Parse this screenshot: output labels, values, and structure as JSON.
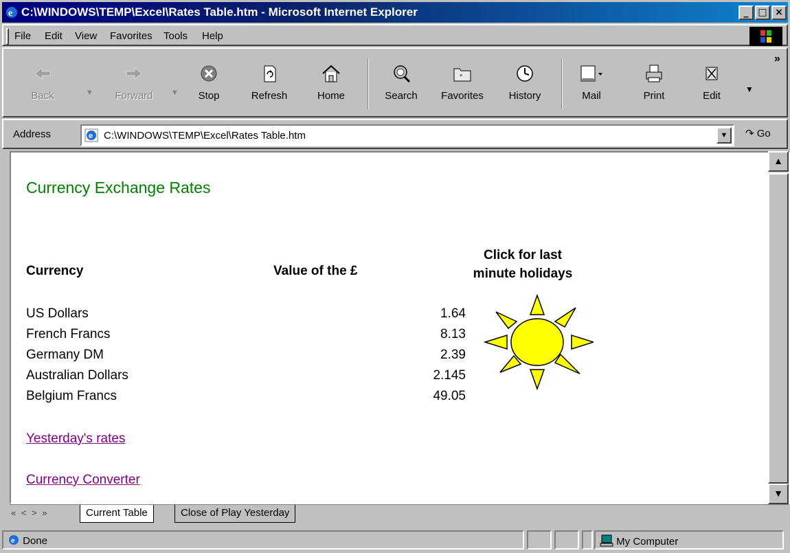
{
  "window": {
    "title": "C:\\WINDOWS\\TEMP\\Excel\\Rates Table.htm - Microsoft Internet Explorer",
    "minimize": "_",
    "maximize": "□",
    "close": "×"
  },
  "menu": {
    "items": [
      {
        "label": "File"
      },
      {
        "label": "Edit"
      },
      {
        "label": "View"
      },
      {
        "label": "Favorites"
      },
      {
        "label": "Tools"
      },
      {
        "label": "Help"
      }
    ]
  },
  "toolbar": {
    "back": "Back",
    "forward": "Forward",
    "stop": "Stop",
    "refresh": "Refresh",
    "home": "Home",
    "search": "Search",
    "favorites": "Favorites",
    "history": "History",
    "mail": "Mail",
    "print": "Print",
    "edit": "Edit",
    "more": "»"
  },
  "address": {
    "label": "Address",
    "value": "C:\\WINDOWS\\TEMP\\Excel\\Rates Table.htm",
    "go": "Go"
  },
  "page": {
    "title": "Currency Exchange Rates",
    "col_currency": "Currency",
    "col_value": "Value of the £",
    "holidays_line1": "Click for last",
    "holidays_line2": "minute holidays",
    "rates": [
      {
        "currency": "US Dollars",
        "value": "1.64"
      },
      {
        "currency": "French Francs",
        "value": "8.13"
      },
      {
        "currency": "Germany DM",
        "value": "2.39"
      },
      {
        "currency": "Australian Dollars",
        "value": "2.145"
      },
      {
        "currency": "Belgium Francs",
        "value": "49.05"
      }
    ],
    "link_yesterday": "Yesterday's rates",
    "link_converter": "Currency Converter",
    "sun_color": "#ffff00"
  },
  "sheet_tabs": {
    "nav": "« < > »",
    "tabs": [
      {
        "label": "Current Table",
        "active": true
      },
      {
        "label": "Close of Play Yesterday",
        "active": false
      }
    ]
  },
  "status": {
    "text": "Done",
    "zone": "My Computer"
  }
}
